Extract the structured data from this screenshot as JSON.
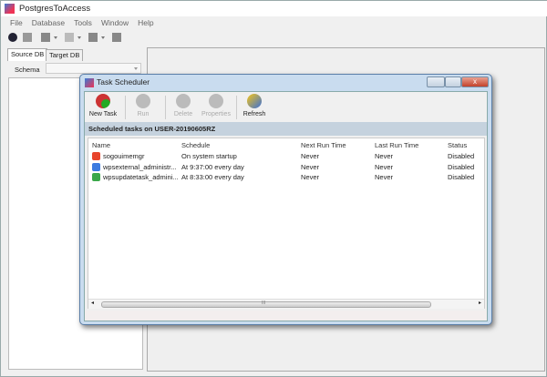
{
  "app": {
    "title": "PostgresToAccess"
  },
  "menu": [
    "File",
    "Database",
    "Tools",
    "Window",
    "Help"
  ],
  "left": {
    "tabs": [
      "Source DB",
      "Target DB"
    ],
    "schema_label": "Schema",
    "schema_value": ""
  },
  "dialog": {
    "title": "Task Scheduler",
    "close": "x",
    "toolbar": [
      {
        "label": "New Task",
        "enabled": true,
        "icon": "new-task-icon"
      },
      {
        "label": "Run",
        "enabled": false,
        "icon": "run-icon"
      },
      {
        "label": "Delete",
        "enabled": false,
        "icon": "delete-icon"
      },
      {
        "label": "Properties",
        "enabled": false,
        "icon": "properties-icon"
      },
      {
        "label": "Refresh",
        "enabled": true,
        "icon": "refresh-icon"
      }
    ],
    "band": "Scheduled tasks on USER-20190605RZ",
    "columns": [
      "Name",
      "Schedule",
      "Next Run Time",
      "Last Run Time",
      "Status"
    ],
    "rows": [
      [
        "sogouimemgr",
        "On system startup",
        "Never",
        "Never",
        "Disabled"
      ],
      [
        "wpsexternal_administr...",
        "At 9:37:00 every day",
        "Never",
        "Never",
        "Disabled"
      ],
      [
        "wpsupdatetask_admini...",
        "At 8:33:00 every day",
        "Never",
        "Never",
        "Disabled"
      ]
    ],
    "row_icon_colors": [
      "#e8452c",
      "#3d7be0",
      "#3aa84a"
    ],
    "scroll_grip": "III"
  }
}
